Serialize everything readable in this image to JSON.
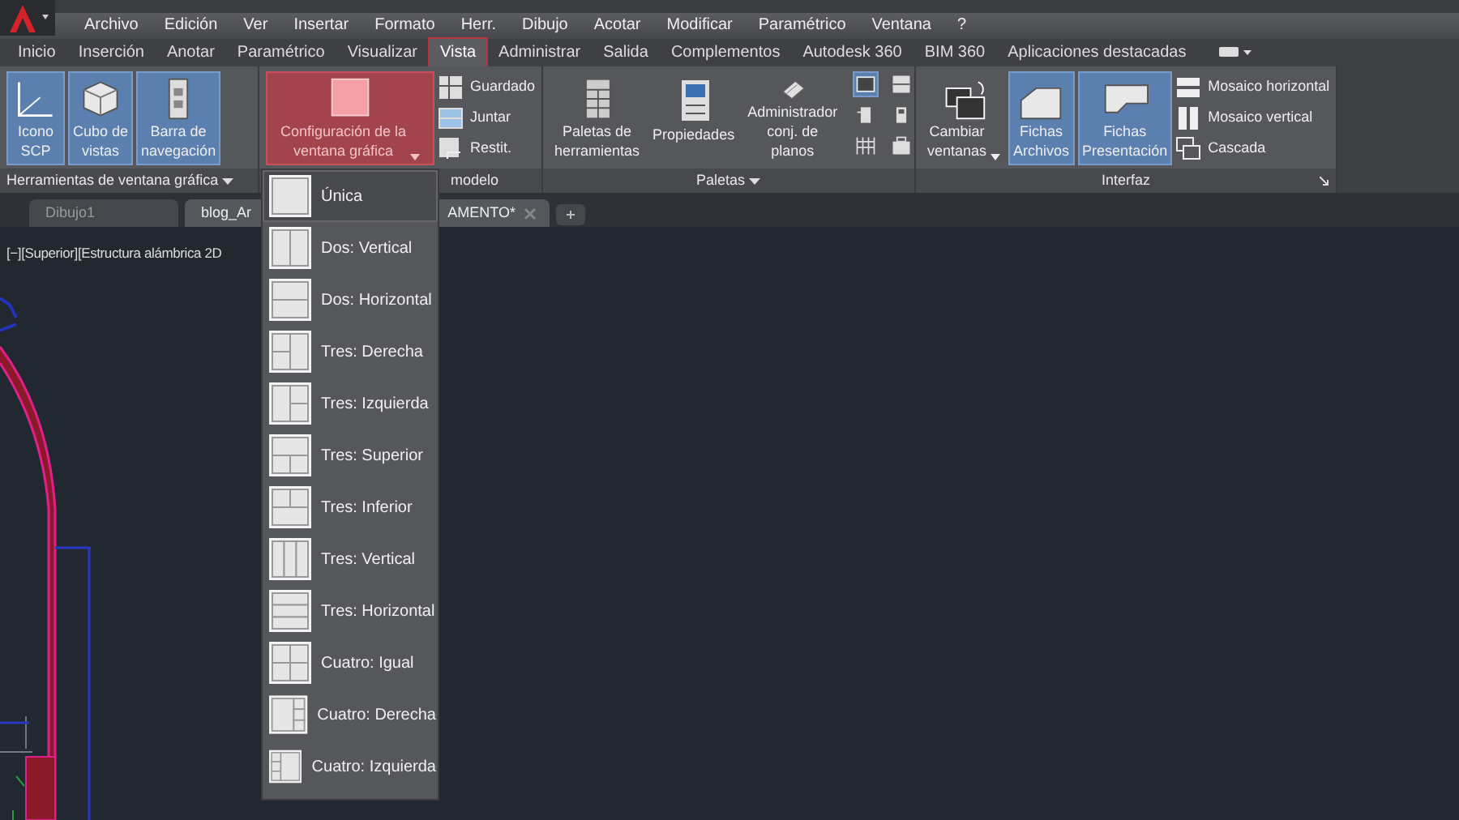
{
  "menu_bar": [
    "Archivo",
    "Edición",
    "Ver",
    "Insertar",
    "Formato",
    "Herr.",
    "Dibujo",
    "Acotar",
    "Modificar",
    "Paramétrico",
    "Ventana",
    "?"
  ],
  "ribbon_tabs": [
    {
      "label": "Inicio",
      "selected": false
    },
    {
      "label": "Inserción",
      "selected": false
    },
    {
      "label": "Anotar",
      "selected": false
    },
    {
      "label": "Paramétrico",
      "selected": false
    },
    {
      "label": "Visualizar",
      "selected": false
    },
    {
      "label": "Vista",
      "selected": true
    },
    {
      "label": "Administrar",
      "selected": false
    },
    {
      "label": "Salida",
      "selected": false
    },
    {
      "label": "Complementos",
      "selected": false
    },
    {
      "label": "Autodesk 360",
      "selected": false
    },
    {
      "label": "BIM 360",
      "selected": false
    },
    {
      "label": "Aplicaciones destacadas",
      "selected": false
    }
  ],
  "ribbon_panels": [
    {
      "title": "Herramientas de ventana gráfica",
      "items": [
        {
          "kind": "large",
          "label": "Icono\nSCP",
          "on": true
        },
        {
          "kind": "large",
          "label": "Cubo de\nvistas",
          "on": true
        },
        {
          "kind": "large",
          "label": "Barra de\nnavegación",
          "on": true
        }
      ]
    },
    {
      "title": "modelo",
      "items": [
        {
          "kind": "split",
          "label": "Configuración de la\nventana gráfica",
          "open": true
        },
        {
          "kind": "small",
          "label": "Guardado"
        },
        {
          "kind": "small",
          "label": "Juntar"
        },
        {
          "kind": "small",
          "label": "Restit."
        }
      ]
    },
    {
      "title": "Paletas",
      "items": [
        {
          "kind": "large",
          "label": "Paletas de\nherramientas",
          "on": false
        },
        {
          "kind": "large",
          "label": "Propiedades",
          "on": false
        },
        {
          "kind": "large",
          "label": "Administrador\nconj. de planos",
          "on": false
        },
        {
          "kind": "iconbtn",
          "on": true
        },
        {
          "kind": "iconbtn",
          "on": false
        },
        {
          "kind": "iconbtn",
          "on": false
        },
        {
          "kind": "iconbtn",
          "on": false
        },
        {
          "kind": "iconbtn",
          "on": false
        },
        {
          "kind": "iconbtn",
          "on": false
        }
      ]
    },
    {
      "title": "Interfaz",
      "items": [
        {
          "kind": "split",
          "label": "Cambiar\nventanas",
          "open": false
        },
        {
          "kind": "large",
          "label": "Fichas\nArchivos",
          "on": true
        },
        {
          "kind": "large",
          "label": "Fichas\nPresentación",
          "on": true
        },
        {
          "kind": "small",
          "label": "Mosaico horizontal"
        },
        {
          "kind": "small",
          "label": "Mosaico vertical"
        },
        {
          "kind": "small",
          "label": "Cascada"
        }
      ]
    }
  ],
  "file_tabs": [
    {
      "label": "Dibujo1",
      "selected": false
    },
    {
      "label": "blog_Ar",
      "label_end": "AMENTO*",
      "selected": true
    }
  ],
  "viewport_label": "[−][Superior][Estructura alámbrica 2D",
  "viewport_menu": [
    {
      "label": "Única",
      "selected": true
    },
    {
      "label": "Dos: Vertical",
      "selected": false
    },
    {
      "label": "Dos: Horizontal",
      "selected": false
    },
    {
      "label": "Tres: Derecha",
      "selected": false
    },
    {
      "label": "Tres: Izquierda",
      "selected": false
    },
    {
      "label": "Tres: Superior",
      "selected": false
    },
    {
      "label": "Tres: Inferior",
      "selected": false
    },
    {
      "label": "Tres: Vertical",
      "selected": false
    },
    {
      "label": "Tres: Horizontal",
      "selected": false
    },
    {
      "label": "Cuatro: Igual",
      "selected": false
    },
    {
      "label": "Cuatro: Derecha",
      "selected": false
    },
    {
      "label": "Cuatro: Izquierda",
      "selected": false
    }
  ]
}
